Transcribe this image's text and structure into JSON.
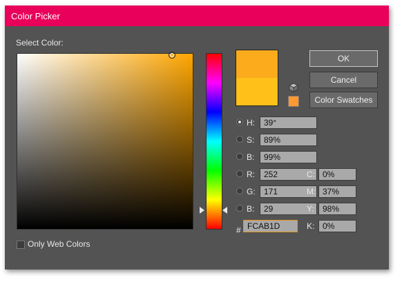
{
  "window": {
    "title": "Color Picker"
  },
  "labels": {
    "select_color": "Select Color:",
    "only_web_colors": "Only Web Colors",
    "hash": "#"
  },
  "buttons": {
    "ok": "OK",
    "cancel": "Cancel",
    "color_swatches": "Color Swatches"
  },
  "colors": {
    "new_color": "#fcab1d",
    "current_color": "#ffc01a",
    "web_safe": "#ff9933",
    "hue_base": "#ffa600",
    "titlebar": "#e8005a"
  },
  "hsb": [
    {
      "label": "H:",
      "value": "39°",
      "selected": true
    },
    {
      "label": "S:",
      "value": "89%",
      "selected": false
    },
    {
      "label": "B:",
      "value": "99%",
      "selected": false
    }
  ],
  "rgb": [
    {
      "label": "R:",
      "value": "252",
      "selected": false
    },
    {
      "label": "G:",
      "value": "171",
      "selected": false
    },
    {
      "label": "B:",
      "value": "29",
      "selected": false
    }
  ],
  "cmyk": [
    {
      "label": "C:",
      "value": "0%"
    },
    {
      "label": "M:",
      "value": "37%"
    },
    {
      "label": "Y:",
      "value": "98%"
    },
    {
      "label": "K:",
      "value": "0%"
    }
  ],
  "hex": {
    "value": "FCAB1D"
  },
  "web_only": {
    "checked": false
  },
  "icons": {
    "web_cube": "cube-icon",
    "picker_ring": "circle-ring-icon",
    "slider_left": "triangle-right-icon",
    "slider_right": "triangle-left-icon"
  }
}
